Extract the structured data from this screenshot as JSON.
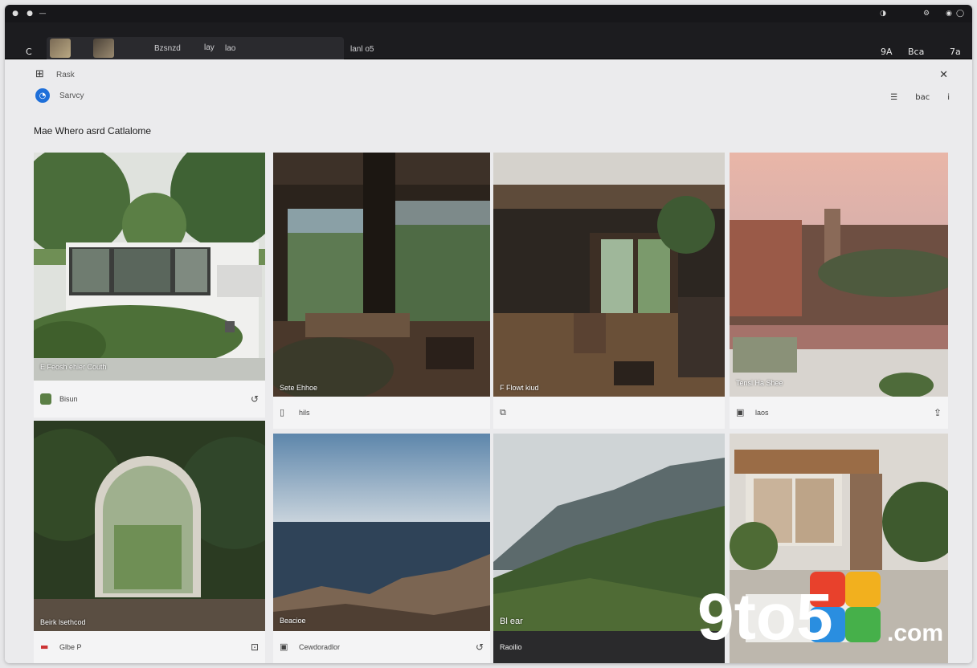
{
  "titlebar": {
    "left_icons": [
      "circle-icon",
      "circle-icon",
      "dash-icon"
    ],
    "right_icons": [
      "refresh-icon",
      "gear-icon",
      "power-icon"
    ],
    "right_glyphs": [
      "◑",
      "⚙",
      "◉",
      "◯"
    ]
  },
  "toolbar": {
    "back_glyph": "C",
    "tab_title": "Bzsnzd",
    "tab_sub": "lay",
    "tab_sub2": "lao",
    "address_text": "lanl o5",
    "right_a": "9A",
    "right_b": "Bca",
    "right_c": "7a"
  },
  "nav": {
    "item1": "Rask",
    "item2": "Sarvcy",
    "grid_glyph": "⊞",
    "badge_glyph": "◔"
  },
  "tools": {
    "close_glyph": "✕",
    "list_glyph": "☰",
    "done_label": "bac",
    "info_glyph": "i"
  },
  "page": {
    "title": "Mae Whero asrd Catlalome"
  },
  "cards": [
    {
      "caption": "E Feosh ehier Couth",
      "footer_label": "Bisun",
      "footer_right": "↺"
    },
    {
      "caption": "Sete Ehhoe",
      "footer_label": "hils",
      "footer_right": ""
    },
    {
      "caption": "F Flowt kiud",
      "footer_label": "",
      "footer_right": ""
    },
    {
      "caption": "Tensl Ha Shee",
      "footer_label": "laos",
      "footer_right": "⇪"
    },
    {
      "caption": "Beirk lsethcod",
      "footer_label": "Glbe P",
      "footer_right": ""
    },
    {
      "caption": "Beacioe",
      "footer_label": "Cewdoradlor",
      "footer_right": "↺"
    },
    {
      "caption": "Bl ear",
      "footer_label": "Raoilio",
      "footer_right": ""
    },
    {
      "caption": "",
      "footer_label": "",
      "footer_right": ""
    }
  ],
  "watermark": {
    "text": "9to5",
    "suffix": ".com"
  },
  "colors": {
    "accent_blue": "#1e6fd9",
    "titlebar_bg": "#17171a",
    "content_bg": "#ebebed"
  }
}
